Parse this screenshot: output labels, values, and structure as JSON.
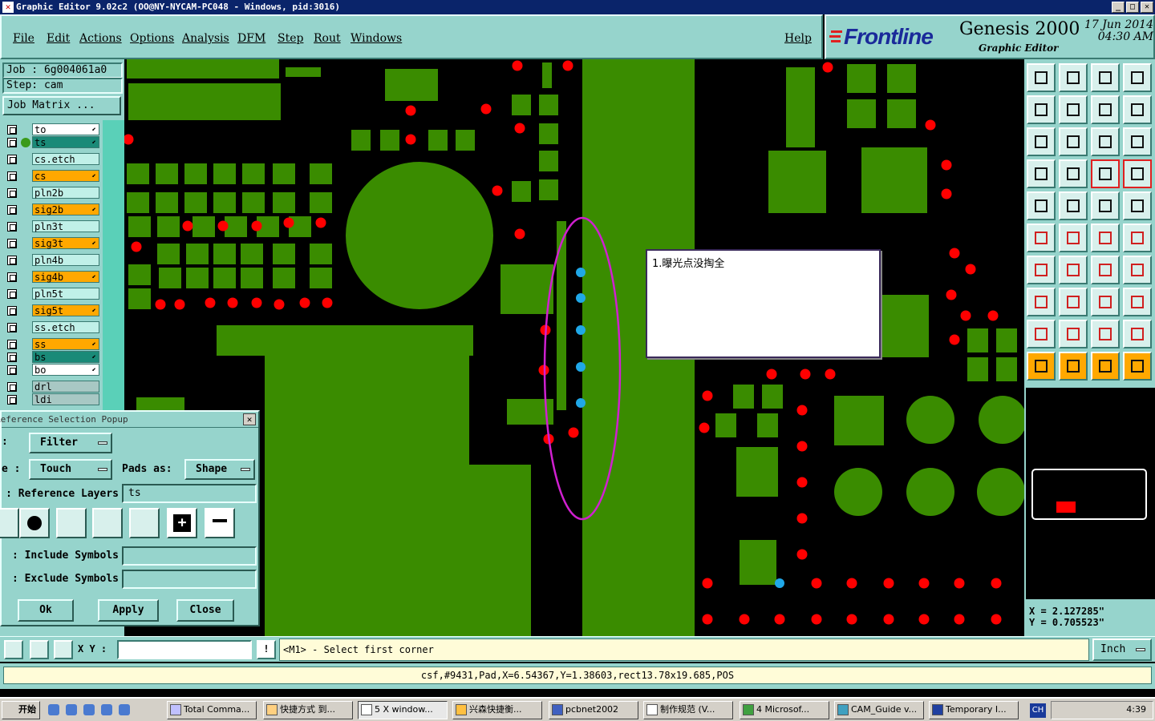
{
  "window": {
    "title": "Graphic Editor 9.02c2  (OO@NY-NYCAM-PC048 - Windows, pid:3016)"
  },
  "menu": {
    "items": [
      "File",
      "Edit",
      "Actions",
      "Options",
      "Analysis",
      "DFM",
      "Step",
      "Rout",
      "Windows"
    ],
    "help": "Help"
  },
  "brand": {
    "logo": "Frontline",
    "product": "Genesis 2000",
    "subtitle": "Graphic Editor",
    "date": "17 Jun 2014",
    "time": "04:30 AM"
  },
  "job": {
    "job_label": "Job  :  6g004061a0",
    "step_label": "Step:  cam",
    "matrix_button": "Job Matrix ..."
  },
  "layers": [
    {
      "name": "to",
      "color": "#ffffff",
      "marker": true,
      "active": false
    },
    {
      "name": "ts",
      "color": "#1a8a78",
      "marker": true,
      "active": true
    },
    {
      "name": "cs.etch",
      "color": "#c0f0e8",
      "marker": false,
      "active": false
    },
    {
      "name": "cs",
      "color": "#ffa800",
      "marker": true,
      "active": false
    },
    {
      "name": "pln2b",
      "color": "#c0f0e8",
      "marker": false,
      "active": false
    },
    {
      "name": "sig2b",
      "color": "#ffa800",
      "marker": true,
      "active": false
    },
    {
      "name": "pln3t",
      "color": "#c0f0e8",
      "marker": false,
      "active": false
    },
    {
      "name": "sig3t",
      "color": "#ffa800",
      "marker": true,
      "active": false
    },
    {
      "name": "pln4b",
      "color": "#c0f0e8",
      "marker": false,
      "active": false
    },
    {
      "name": "sig4b",
      "color": "#ffa800",
      "marker": true,
      "active": false
    },
    {
      "name": "pln5t",
      "color": "#c0f0e8",
      "marker": false,
      "active": false
    },
    {
      "name": "sig5t",
      "color": "#ffa800",
      "marker": true,
      "active": false
    },
    {
      "name": "ss.etch",
      "color": "#c0f0e8",
      "marker": false,
      "active": false
    },
    {
      "name": "ss",
      "color": "#ffa800",
      "marker": true,
      "active": false
    },
    {
      "name": "bs",
      "color": "#1a8a78",
      "marker": true,
      "active": false
    },
    {
      "name": "bo",
      "color": "#ffffff",
      "marker": true,
      "active": false
    },
    {
      "name": "drl",
      "color": "#a8c8c4",
      "marker": false,
      "active": false
    },
    {
      "name": "ldi",
      "color": "#a8c8c4",
      "marker": false,
      "active": false
    }
  ],
  "popup": {
    "title": "Reference Selection Popup",
    "filter_label": "Filter",
    "mode_label": "Touch",
    "pads_as_label": "Pads as:",
    "pads_as_value": "Shape",
    "ref_layers_label": "Reference Layers :",
    "ref_layers_value": "ts",
    "include_label": "Include Symbols :",
    "exclude_label": "Exclude Symbols :",
    "ok": "Ok",
    "apply": "Apply",
    "close": "Close"
  },
  "annotation": {
    "text": "1.曝光点没掏全"
  },
  "coords": {
    "x": "X  =  2.127285\"",
    "y": "Y  =  0.705523\""
  },
  "bottom": {
    "xy_label": "X Y :",
    "prompt": "<M1> - Select first corner",
    "units": "Inch"
  },
  "status": {
    "text": "csf,#9431,Pad,X=6.54367,Y=1.38603,rect13.78x19.685,POS"
  },
  "taskbar": {
    "start": "开始",
    "tasks": [
      "Total Comma...",
      "快捷方式 到...",
      "5 X window...",
      "兴森快捷衡...",
      "pcbnet2002",
      "制作规范  (V...",
      "4 Microsof...",
      "CAM_Guide v...",
      "Temporary I..."
    ],
    "lang": "CH",
    "clock": "4:39"
  },
  "colors": {
    "teal": "#96d4cc",
    "copper": "#3a8c00",
    "pad_red": "#ff0000",
    "pad_blue": "#20a8e8",
    "highlight": "#d020d0"
  }
}
